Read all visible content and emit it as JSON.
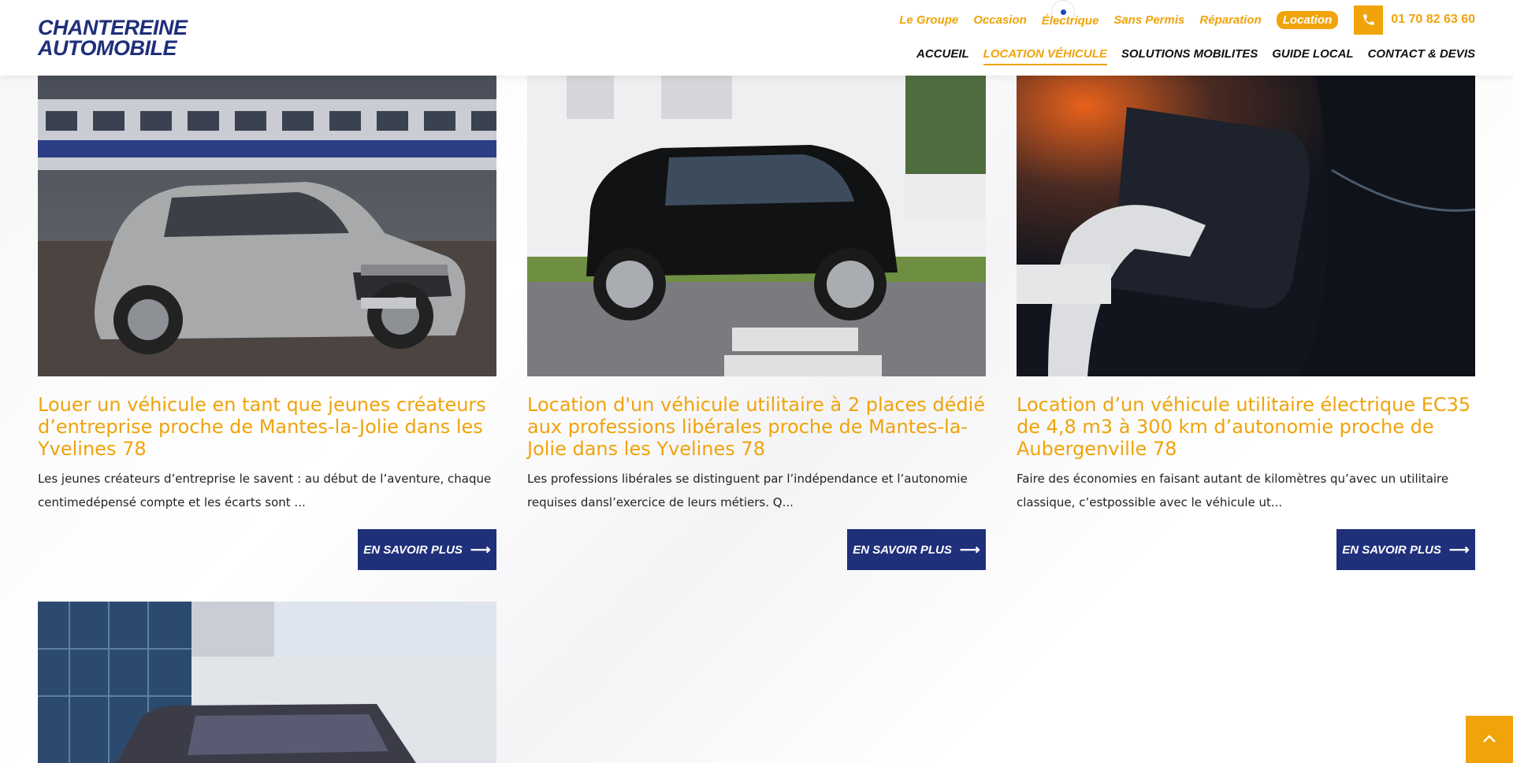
{
  "brand": {
    "line1": "CHANTEREINE",
    "line2": "AUTOMOBILE",
    "primary_color": "#1f2f7a",
    "accent_color": "#f0a30a"
  },
  "top_nav": {
    "items": [
      "Le Groupe",
      "Occasion",
      "Électrique",
      "Sans Permis",
      "Réparation"
    ],
    "active": "Location",
    "phone_icon": "phone-icon",
    "phone": "01 70 82 63 60"
  },
  "main_nav": {
    "items": [
      "ACCUEIL",
      "LOCATION VÉHICULE",
      "SOLUTIONS MOBILITES",
      "GUIDE LOCAL",
      "CONTACT & DEVIS"
    ],
    "current_index": 1
  },
  "cards": [
    {
      "title": "Louer un véhicule en tant que jeunes créateurs d’entreprise proche de Mantes-la-Jolie dans les Yvelines 78",
      "excerpt": "Les jeunes créateurs d’entreprise le savent : au début de l’aventure, chaque centimedépensé compte et les écarts sont ...",
      "button": "EN SAVOIR PLUS",
      "image": "silver-hatchback-photo"
    },
    {
      "title": "Location d'un véhicule utilitaire à 2 places dédié aux professions libérales proche de Mantes-la-Jolie dans les Yvelines 78",
      "excerpt": "Les professions libérales se distinguent par l’indépendance et l’autonomie requises dansl’exercice de leurs métiers. Q...",
      "button": "EN SAVOIR PLUS",
      "image": "black-city-car-photo"
    },
    {
      "title": "Location d’un véhicule utilitaire électrique EC35 de 4,8 m3 à 300 km d’autonomie proche de Aubergenville 78",
      "excerpt": "Faire des économies en faisant autant de kilomètres qu’avec un utilitaire classique, c’estpossible avec le véhicule ut...",
      "button": "EN SAVOIR PLUS",
      "image": "ev-charging-photo"
    },
    {
      "image": "van-building-photo"
    }
  ],
  "scroll_top_icon": "chevron-up-icon"
}
